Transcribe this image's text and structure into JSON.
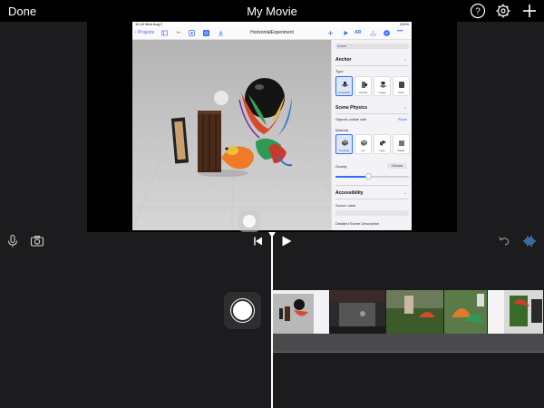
{
  "app": {
    "done_label": "Done",
    "title": "My Movie",
    "icons": [
      "help-icon",
      "settings-gear-icon",
      "add-plus-icon"
    ]
  },
  "ipad": {
    "status_time": "11:18",
    "status_date": "Wed Aug 2",
    "status_battery": "100%",
    "back_label": "Projects",
    "document_title": "HorizontalExperiment",
    "toolbar_icons": [
      "sidebar-icon",
      "undo-icon",
      "frame-icon",
      "anchor-icon",
      "download-icon",
      "plus-icon",
      "play-icon",
      "ar-icon",
      "share-icon",
      "inspector-icon",
      "more-icon"
    ],
    "ar_label": "AR"
  },
  "inspector": {
    "scene_tag": "Scene",
    "anchor": {
      "title": "Anchor",
      "type_label": "Type",
      "types": [
        "Horizontal",
        "Vertical",
        "Image",
        "Face"
      ]
    },
    "physics": {
      "title": "Scene Physics",
      "collide_label": "Objects collide with",
      "collide_value": "Plane",
      "material_label": "Material",
      "materials": [
        "Concrete",
        "Ice",
        "Lego",
        "Plastic"
      ],
      "gravity_label": "Gravity",
      "gravity_value": "9.8 m/s²",
      "gravity_fraction": 0.45
    },
    "accessibility": {
      "title": "Accessibility",
      "scene_label": "Scene Label",
      "description_label": "Detailed Scene Description"
    }
  },
  "colors": {
    "accent": "#2f6ef5",
    "background": "#1c1c1e",
    "scene_floor": "#c6c6c6"
  }
}
